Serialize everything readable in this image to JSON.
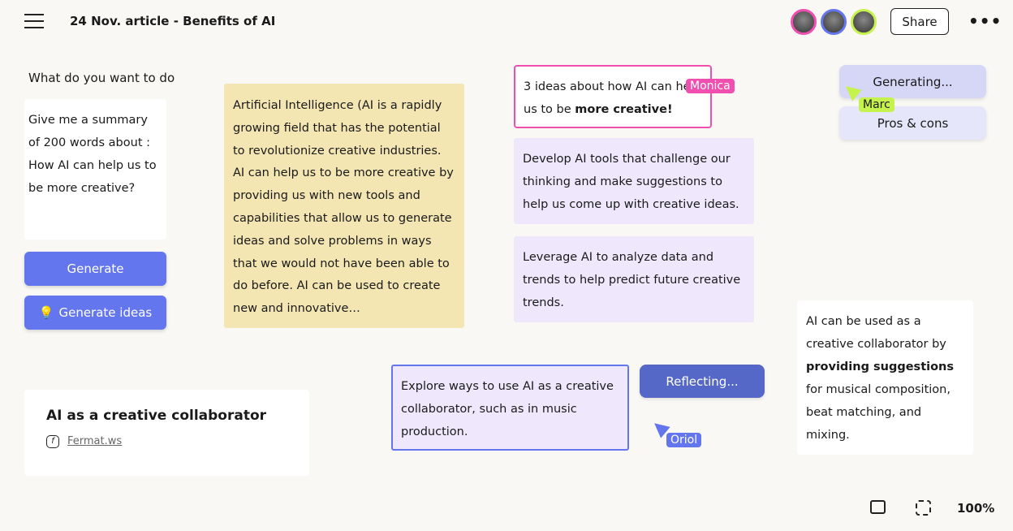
{
  "header": {
    "title": "24 Nov. article - Benefits of AI",
    "share_label": "Share",
    "more_label": "•••",
    "avatars": [
      {
        "color": "#f04fb0"
      },
      {
        "color": "#6376ee"
      },
      {
        "color": "#c6f24e"
      }
    ]
  },
  "prompt": {
    "label": "What do you want to do",
    "text": "Give me a summary of 200 words about : How AI can help us to be more creative?",
    "generate_label": "Generate",
    "generate_ideas_label": "Generate ideas"
  },
  "summary": {
    "text": "Artificial Intelligence (AI is a rapidly growing field that has the potential to revolutionize creative industries. AI can help us to be more creative by providing us with new tools and capabilities that allow us to generate ideas and solve problems in ways that we would not have been able to do before. AI can be used to create new and innovative…"
  },
  "ideas": {
    "prompt_plain": "3 ideas about how AI can help us to be ",
    "prompt_bold": "more creative",
    "prompt_end": "!",
    "items": [
      "Develop AI tools that challenge our thinking and make suggestions to help us come up with creative ideas.",
      "Leverage AI to analyze data and trends to help predict future creative trends."
    ]
  },
  "actions": {
    "generating_label": "Generating...",
    "pros_cons_label": "Pros & cons",
    "reflecting_label": "Reflecting..."
  },
  "explore": {
    "text": "Explore ways to use AI as a creative collaborator, such as in music production."
  },
  "collab": {
    "pre": "AI can be used as a creative collaborator by ",
    "bold": "providing suggestions",
    "post": " for musical composition, beat matching, and mixing."
  },
  "link_card": {
    "title": "AI as a creative collaborator",
    "source": "Fermat.ws"
  },
  "cursors": {
    "monica": "Monica",
    "marc": "Marc",
    "oriol": "Oriol"
  },
  "footer": {
    "zoom": "100%"
  },
  "colors": {
    "accent": "#6376ee",
    "monica": "#f04fb0",
    "marc": "#c6f24e",
    "summary_bg": "#f3e6b3",
    "idea_bg": "#efe8fd"
  }
}
